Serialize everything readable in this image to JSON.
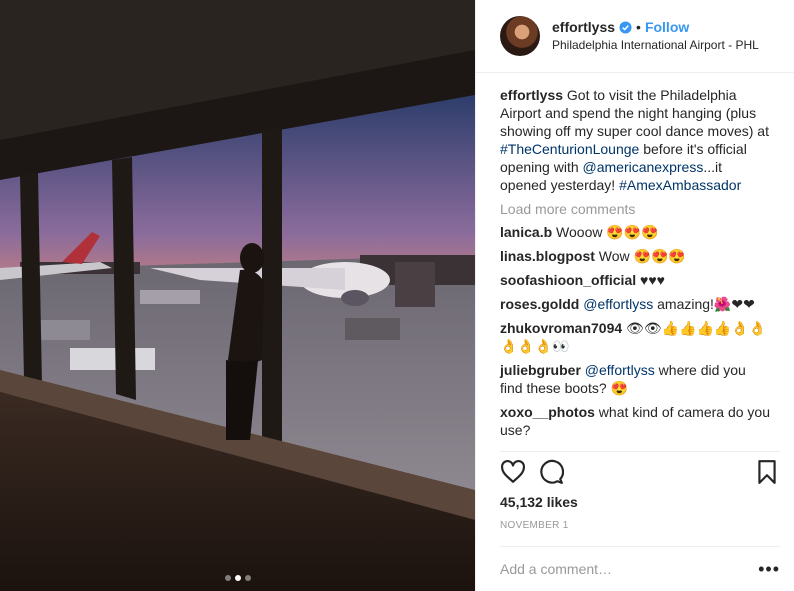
{
  "post": {
    "username": "effortlyss",
    "follow_label": "Follow",
    "separator": "•",
    "location": "Philadelphia International Airport - PHL",
    "caption": {
      "user": "effortlyss",
      "t1": " Got to visit the Philadelphia Airport and spend the night hanging (plus showing off my super cool dance moves) at ",
      "tag1": "#TheCenturionLounge",
      "t2": " before it's official opening with ",
      "mention": "@americanexpress",
      "t3": "...it opened yesterday! ",
      "tag2": "#AmexAmbassador"
    },
    "load_more": "Load more comments",
    "comments": [
      {
        "user": "lanica.b",
        "mention": "",
        "text": " Wooow 😍😍😍"
      },
      {
        "user": "linas.blogpost",
        "mention": "",
        "text": " Wow 😍😍😍"
      },
      {
        "user": "soofashioon_official",
        "mention": "",
        "text": " ♥♥♥"
      },
      {
        "user": "roses.goldd",
        "mention": " @effortlyss",
        "text": " amazing!🌺❤❤"
      },
      {
        "user": "zhukovroman7094",
        "mention": "",
        "text": " 👁👁👍👍👍👍👌👌👌👌👌👀"
      },
      {
        "user": "juliebgruber",
        "mention": " @effortlyss",
        "text": " where did you find these boots? 😍"
      },
      {
        "user": "xoxo__photos",
        "mention": "",
        "text": " what kind of camera do you use?"
      }
    ],
    "likes": "45,132 likes",
    "date": "NOVEMBER 1",
    "comment_placeholder": "Add a comment…",
    "more_label": "•••",
    "icons": {
      "like": "heart-icon",
      "comment": "comment-icon",
      "save": "bookmark-icon",
      "verified": "verified-badge-icon"
    },
    "colors": {
      "link": "#003569",
      "follow": "#3897f0",
      "muted": "#999999",
      "verified": "#3897f0"
    },
    "carousel": {
      "count": 3,
      "active": 2
    }
  }
}
